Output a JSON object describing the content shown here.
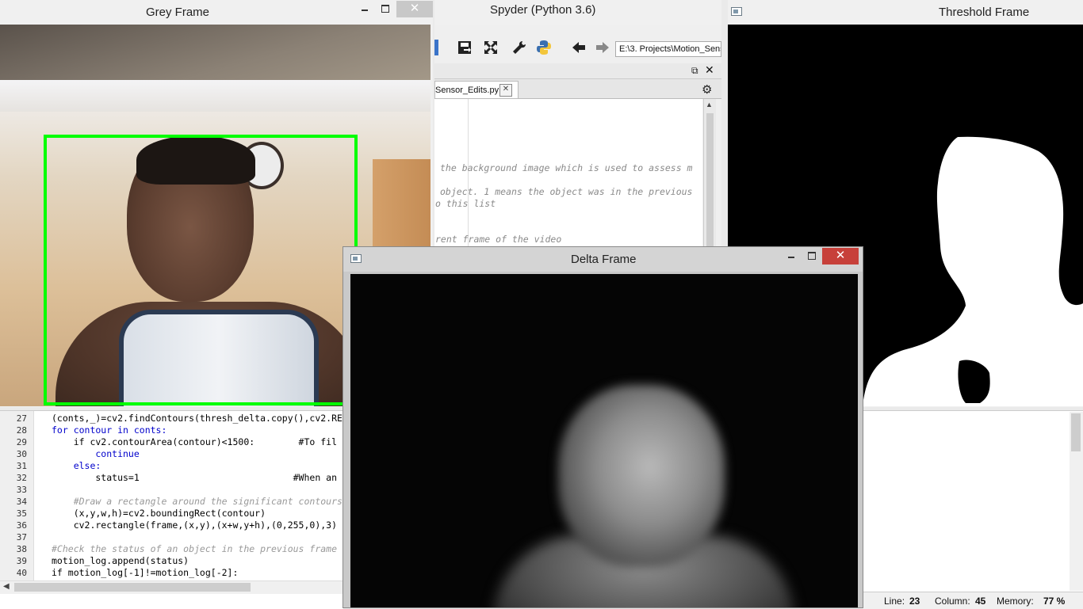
{
  "windows": {
    "grey": {
      "title": "Grey Frame",
      "close": "✕"
    },
    "spyder": {
      "title": "Spyder (Python 3.6)",
      "path": "E:\\3. Projects\\Motion_Sens",
      "tab_label": "Sensor_Edits.py",
      "tab_close": "✕",
      "comments": [
        "the background image which is used to assess m",
        "object. 1 means the object was in the previous",
        "o this list",
        "rent frame of the video"
      ]
    },
    "threshold": {
      "title": "Threshold Frame"
    },
    "delta": {
      "title": "Delta Frame",
      "close": "✕"
    }
  },
  "code": {
    "lines": [
      {
        "n": "27",
        "text": "(conts,_)=cv2.findContours(thresh_delta.copy(),cv2.RE"
      },
      {
        "n": "28",
        "text": "for contour in conts:"
      },
      {
        "n": "29",
        "text": "    if cv2.contourArea(contour)<1500:        #To fil"
      },
      {
        "n": "30",
        "text": "        continue"
      },
      {
        "n": "31",
        "text": "    else:"
      },
      {
        "n": "32",
        "text": "        status=1                            #When an"
      },
      {
        "n": "33",
        "text": ""
      },
      {
        "n": "34",
        "text": "    #Draw a rectangle around the significant contours"
      },
      {
        "n": "35",
        "text": "    (x,y,w,h)=cv2.boundingRect(contour)"
      },
      {
        "n": "36",
        "text": "    cv2.rectangle(frame,(x,y),(x+w,y+h),(0,255,0),3)"
      },
      {
        "n": "37",
        "text": ""
      },
      {
        "n": "38",
        "text": "#Check the status of an object in the previous frame"
      },
      {
        "n": "39",
        "text": "motion_log.append(status)"
      },
      {
        "n": "40",
        "text": "if motion_log[-1]!=motion_log[-2]:"
      }
    ]
  },
  "statusbar": {
    "line_label": "Line:",
    "line_value": "23",
    "column_label": "Column:",
    "column_value": "45",
    "memory_label": "Memory:",
    "memory_value": "77 %"
  },
  "icons": [
    "minimize-icon",
    "maximize-icon",
    "close-icon",
    "window-icon",
    "save-as-icon",
    "fullscreen-icon",
    "wrench-icon",
    "python-icon",
    "back-arrow-icon",
    "forward-arrow-icon",
    "gear-icon",
    "undock-icon"
  ],
  "colors": {
    "detection_box": "#00ff00",
    "close_red": "#c7403a"
  }
}
